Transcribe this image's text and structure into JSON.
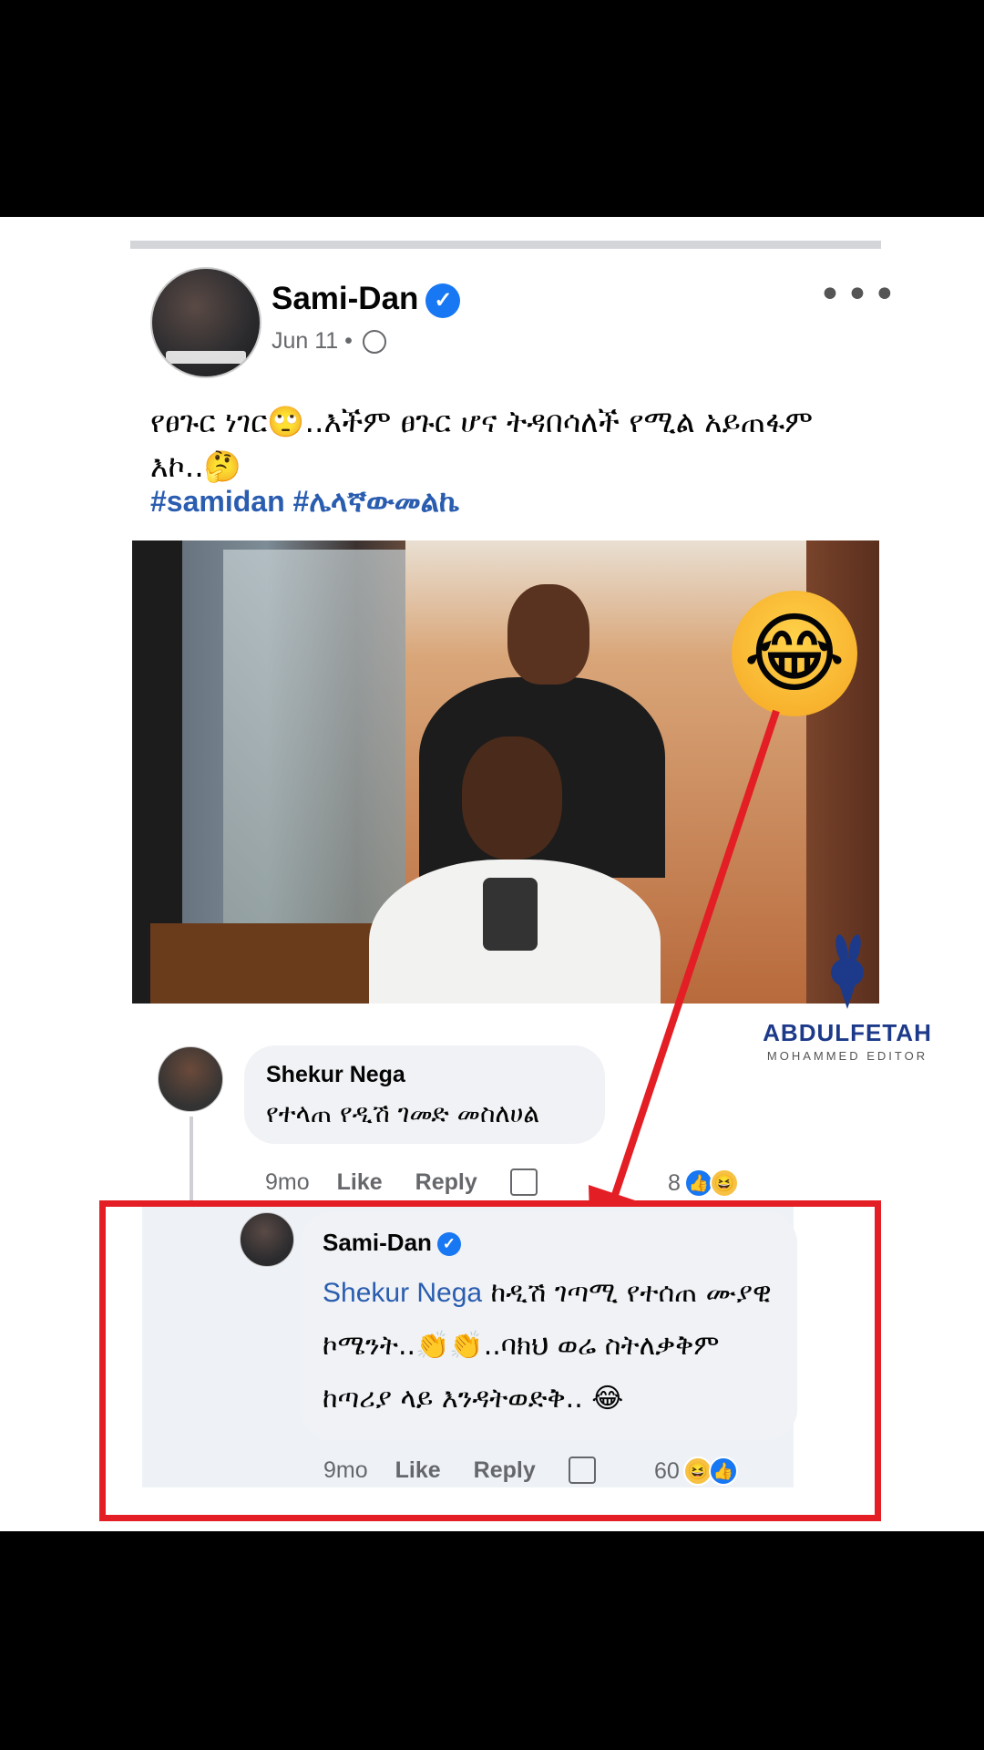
{
  "post": {
    "author": "Sami-Dan",
    "date": "Jun 11",
    "separator": "•",
    "more": "•••",
    "text": "የፀጉር ነገር🙄..እችም ፀጉር ሆና ትዳበሳለች የሚል አይጠፋም እኮ..🤔",
    "hashtags": "#samidan #ሌላኛውመልኬ",
    "sticker": "😂"
  },
  "watermark": {
    "name": "ABDULFETAH",
    "subtitle": "MOHAMMED EDITOR"
  },
  "comments": [
    {
      "author": "Shekur Nega",
      "text": "የተላጠ የዲሽ ገመድ መስለሀል",
      "time": "9mo",
      "like": "Like",
      "reply": "Reply",
      "reaction_count": "8",
      "reaction_icons": [
        "like",
        "haha"
      ]
    },
    {
      "author": "Sami-Dan",
      "mention": "Shekur Nega",
      "text": " ከዲሽ ገጣሚ የተሰጠ ሙያዊ ኮሜንት..👏👏..ባክህ ወሬ ስትለቃቅም ከጣሪያ ላይ እንዳትወድቅ.. 😂",
      "time": "9mo",
      "like": "Like",
      "reply": "Reply",
      "reaction_count": "60",
      "reaction_icons": [
        "haha",
        "like"
      ]
    }
  ],
  "colors": {
    "highlight": "#e31e24",
    "link": "#2a5db0",
    "verified": "#1877f2",
    "watermark": "#1d3a8a"
  }
}
